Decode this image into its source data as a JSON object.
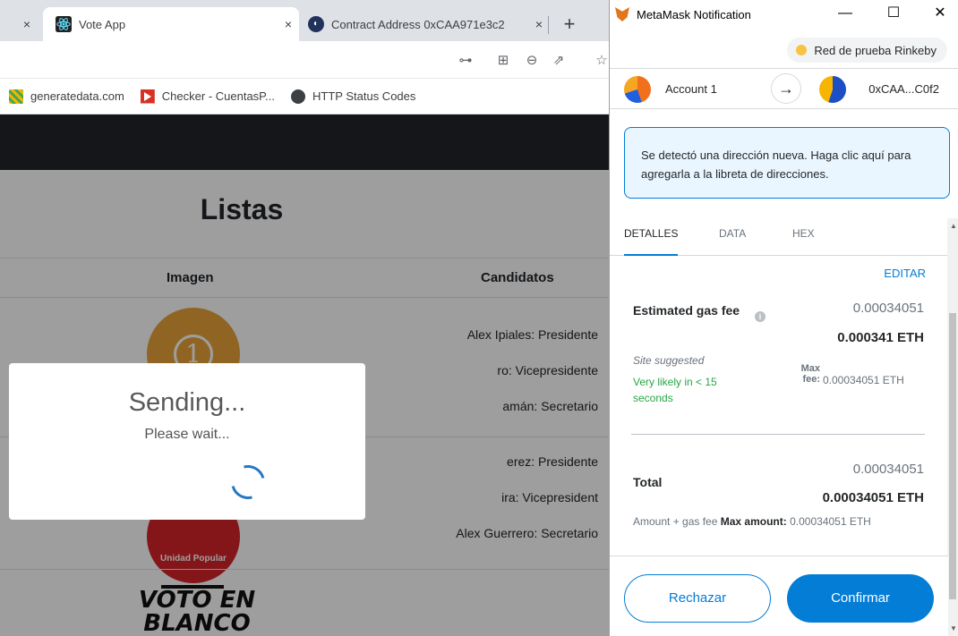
{
  "browser": {
    "tabs": [
      {
        "title": "Vote App",
        "close": "×"
      },
      {
        "title": "Contract Address 0xCAA971e3c2",
        "close": "×"
      }
    ],
    "partial_tab_close": "×",
    "new_tab": "+",
    "bookmarks": [
      "generatedata.com",
      "Checker - CuentasP...",
      "HTTP Status Codes"
    ]
  },
  "page": {
    "title": "Listas",
    "columns": [
      "Imagen",
      "Candidatos"
    ],
    "candidates": [
      "Alex Ipiales: Presidente",
      "ro: Vicepresidente",
      "amán: Secretario",
      "erez: Presidente",
      "ira: Vicepresident",
      "Alex Guerrero: Secretario"
    ],
    "logo1_number": "1",
    "logo2_label": "Unidad Popular",
    "blank_vote_text": "VOTO EN BLANCO"
  },
  "modal": {
    "title": "Sending...",
    "text": "Please wait..."
  },
  "metamask": {
    "window_title": "MetaMask Notification",
    "window_buttons": [
      "—",
      "☐",
      "✕"
    ],
    "network": "Red de prueba Rinkeby",
    "account": "Account 1",
    "arrow": "→",
    "recipient": "0xCAA...C0f2",
    "notice": "Se detectó una dirección nueva. Haga clic aquí para agregarla a la libreta de direcciones.",
    "tabs": [
      "DETALLES",
      "DATA",
      "HEX"
    ],
    "edit": "EDITAR",
    "gas_label": "Estimated gas fee",
    "info_glyph": "i",
    "gas_value": "0.00034051",
    "gas_eth": "0.000341 ETH",
    "site_suggested": "Site suggested",
    "likelihood": "Very likely in < 15 seconds",
    "max_fee_label": "Max fee:",
    "max_fee_value": "0.00034051 ETH",
    "total_label": "Total",
    "total_value": "0.00034051",
    "total_eth": "0.00034051 ETH",
    "amount_caption": "Amount + gas fee",
    "max_amount_label": "Max amount:",
    "max_amount_value": "0.00034051 ETH",
    "reject": "Rechazar",
    "confirm": "Confirmar"
  },
  "colors": {
    "metamask_blue": "#037dd6",
    "success_green": "#28a745",
    "navbar_dark": "#212529"
  }
}
